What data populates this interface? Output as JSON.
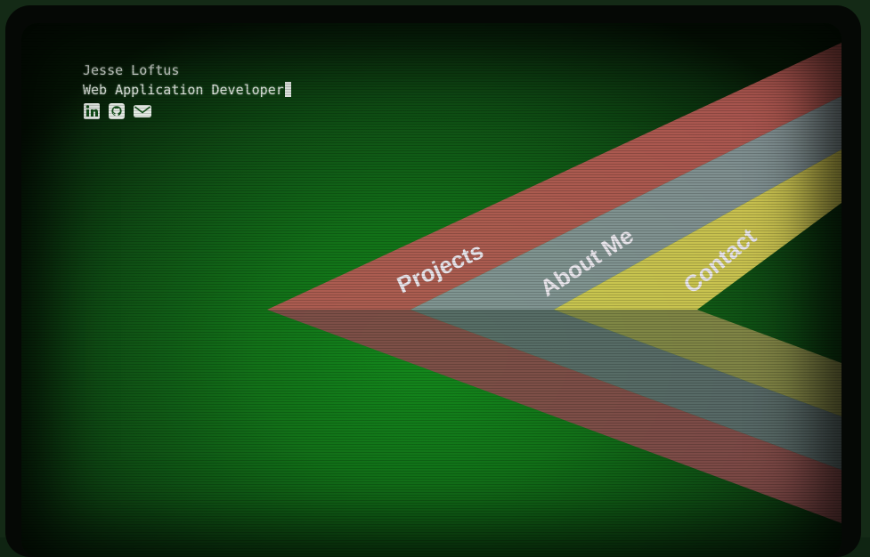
{
  "header": {
    "name": "Jesse Loftus",
    "tagline": "Web Application Developer"
  },
  "social": [
    {
      "icon": "linkedin-icon"
    },
    {
      "icon": "github-icon"
    },
    {
      "icon": "email-icon"
    }
  ],
  "nav": {
    "projects": "Projects",
    "about": "About Me",
    "contact": "Contact"
  },
  "colors": {
    "red_band": "#b85a55",
    "gray_band": "#7d8a8e",
    "yellow_band": "#cfc456",
    "text": "#e6ece6",
    "background": "#127118"
  }
}
